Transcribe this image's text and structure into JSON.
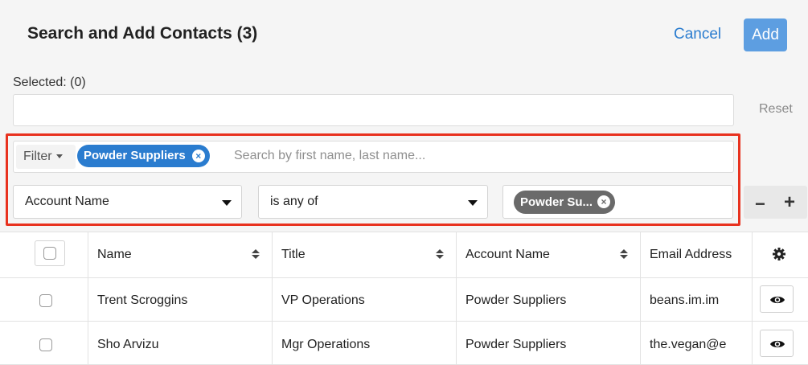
{
  "header": {
    "title": "Search and Add Contacts (3)",
    "cancel_label": "Cancel",
    "add_label": "Add"
  },
  "selected": {
    "label": "Selected: (0)",
    "reset_label": "Reset"
  },
  "filter": {
    "button_label": "Filter",
    "active_filter": "Powder Suppliers",
    "search_placeholder": "Search by first name, last name...",
    "field": "Account Name",
    "operator": "is any of",
    "value_pill": "Powder Su..."
  },
  "table": {
    "columns": [
      "Name",
      "Title",
      "Account Name",
      "Email Address"
    ],
    "rows": [
      {
        "name": "Trent Scroggins",
        "title": "VP Operations",
        "account": "Powder Suppliers",
        "email": "beans.im.im"
      },
      {
        "name": "Sho Arvizu",
        "title": "Mgr Operations",
        "account": "Powder Suppliers",
        "email": "the.vegan@e"
      }
    ]
  },
  "colors": {
    "accent": "#2a7ccf",
    "add_button": "#5d9ee1",
    "highlight": "#e8321f"
  }
}
